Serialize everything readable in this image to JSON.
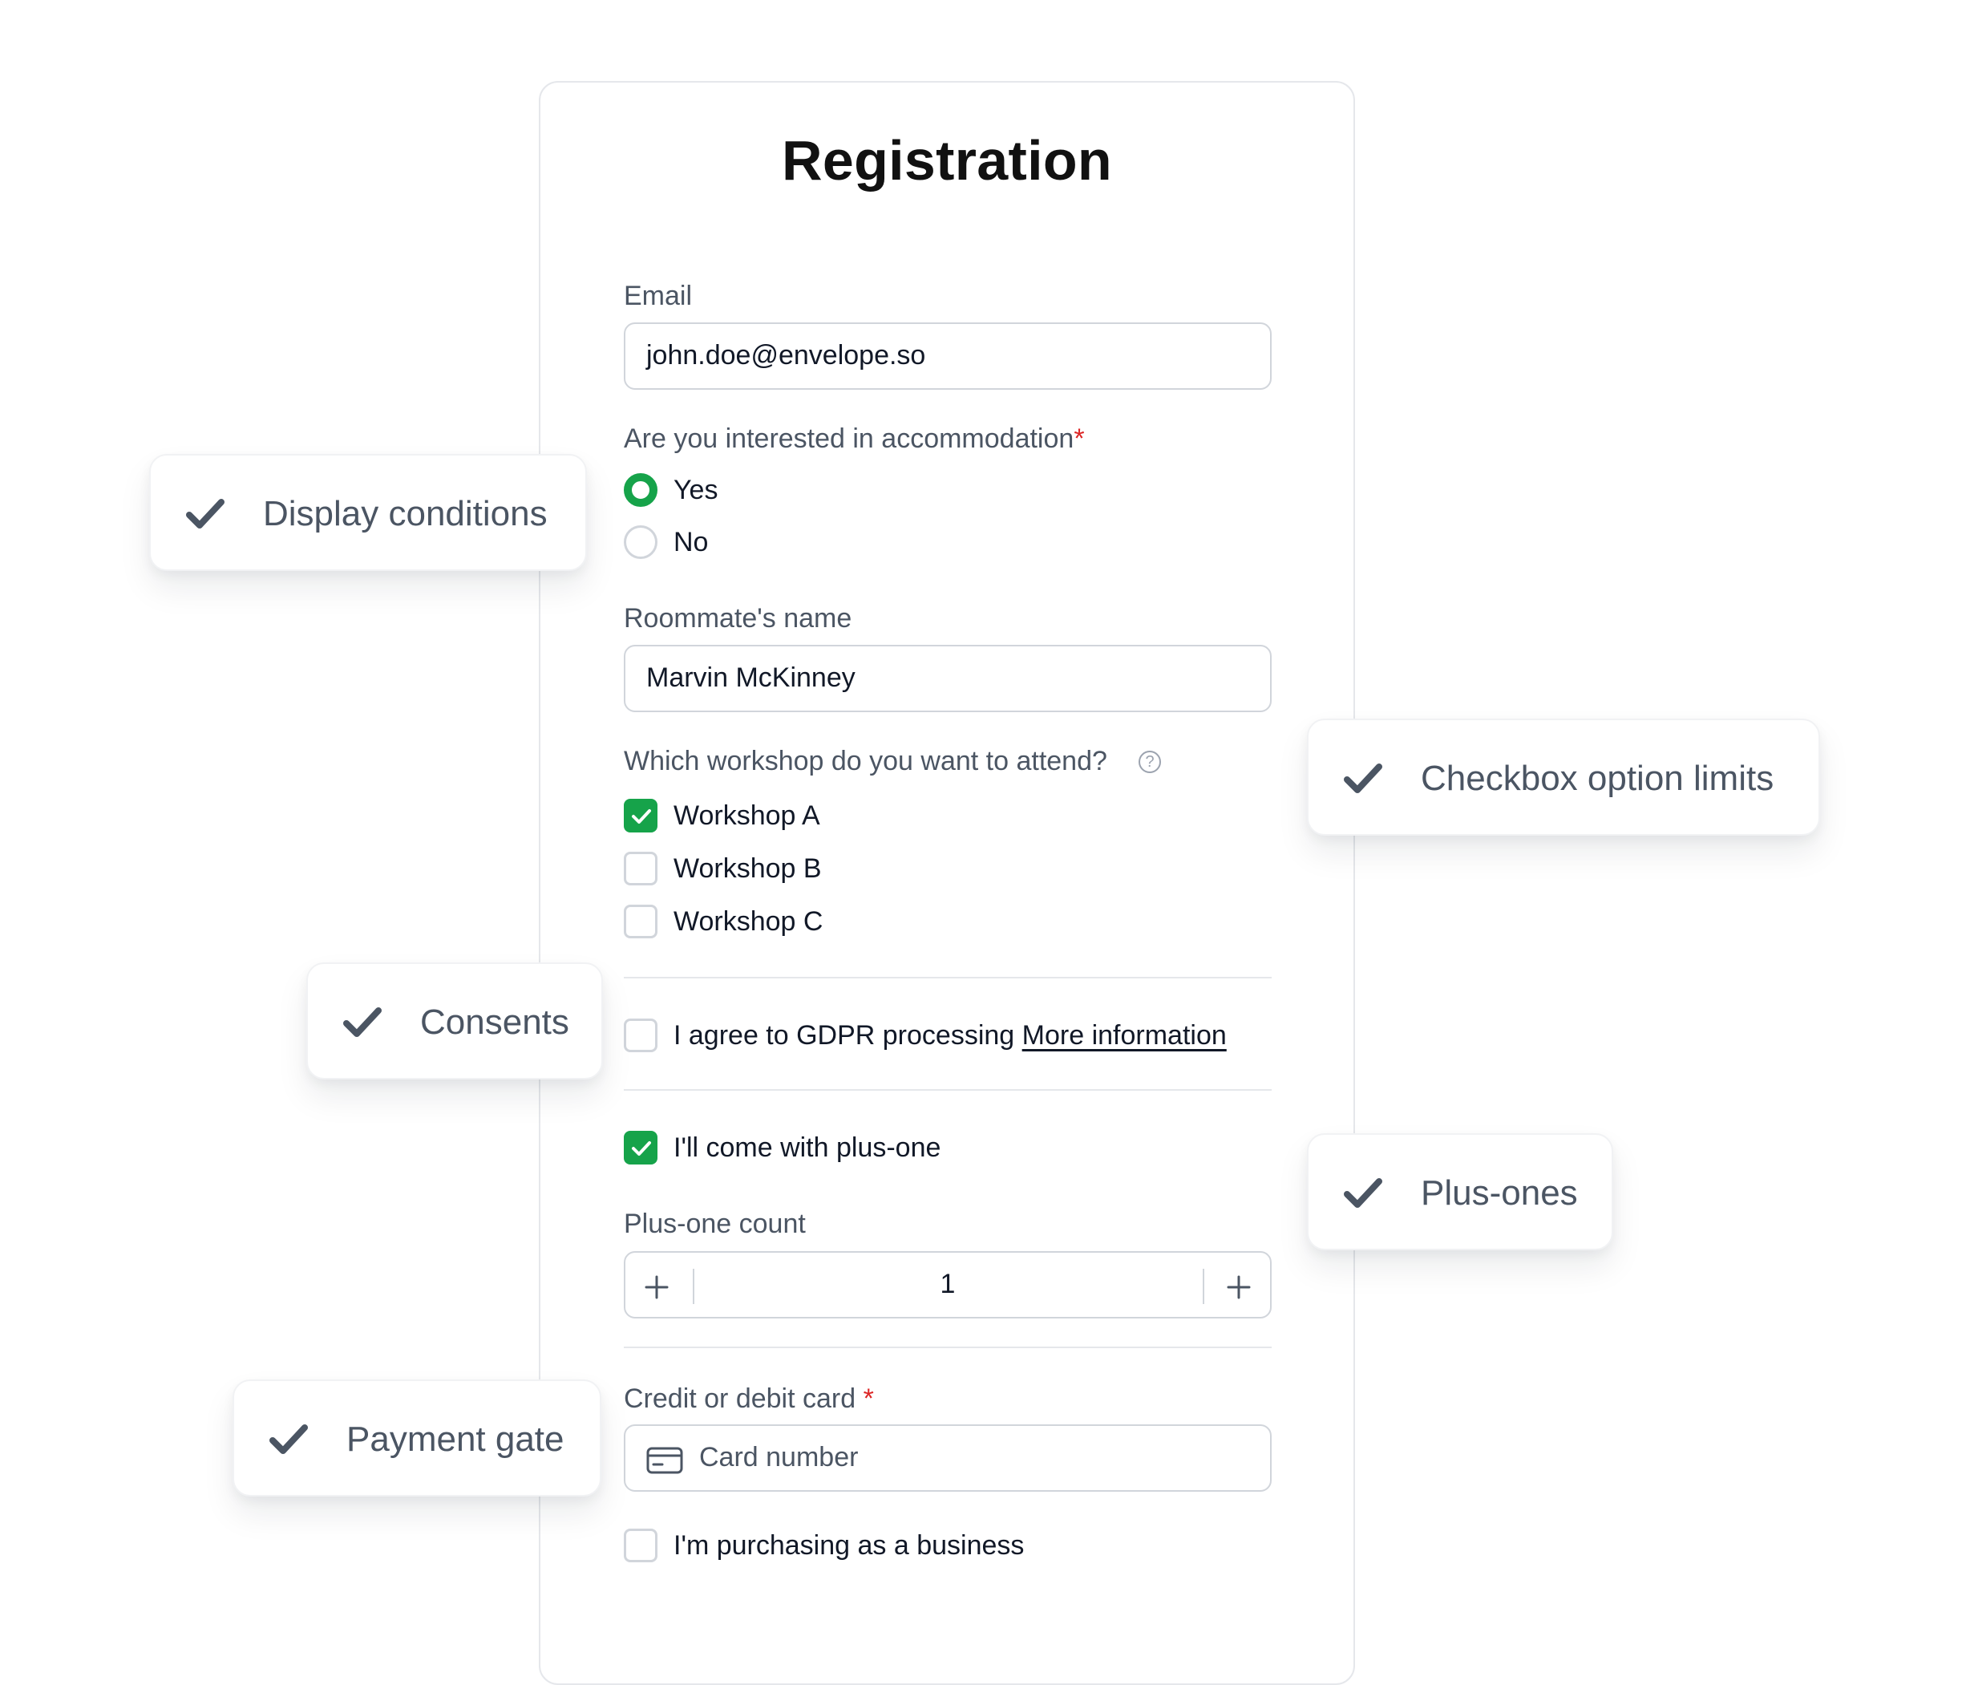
{
  "form": {
    "title": "Registration",
    "email": {
      "label": "Email",
      "value": "john.doe@envelope.so"
    },
    "accommodation": {
      "label": "Are you interested in accommodation",
      "required_mark": "*",
      "options": [
        {
          "label": "Yes",
          "selected": true
        },
        {
          "label": "No",
          "selected": false
        }
      ]
    },
    "roommate": {
      "label": "Roommate's name",
      "value": "Marvin McKinney"
    },
    "workshop": {
      "label": "Which workshop do you want to attend?",
      "help_icon": "question-circle-icon",
      "options": [
        {
          "label": "Workshop A",
          "checked": true
        },
        {
          "label": "Workshop B",
          "checked": false
        },
        {
          "label": "Workshop C",
          "checked": false
        }
      ]
    },
    "gdpr": {
      "text": "I agree to GDPR processing",
      "link": "More information",
      "checked": false
    },
    "plus_one": {
      "label": "I'll come with plus-one",
      "checked": true
    },
    "plus_one_count": {
      "label": "Plus-one count",
      "value": "1"
    },
    "card": {
      "label": "Credit or debit card",
      "required_mark": "*",
      "placeholder": "Card number",
      "icon": "credit-card-icon"
    },
    "business": {
      "label": "I'm purchasing as a business",
      "checked": false
    }
  },
  "badges": [
    "Display conditions",
    "Checkbox option limits",
    "Consents",
    "Plus-ones",
    "Payment gate"
  ],
  "colors": {
    "accent": "#16a34a",
    "required": "#dc2626",
    "border": "#d1d5db",
    "label": "#4b5563",
    "badge_check": "#4b5563"
  }
}
